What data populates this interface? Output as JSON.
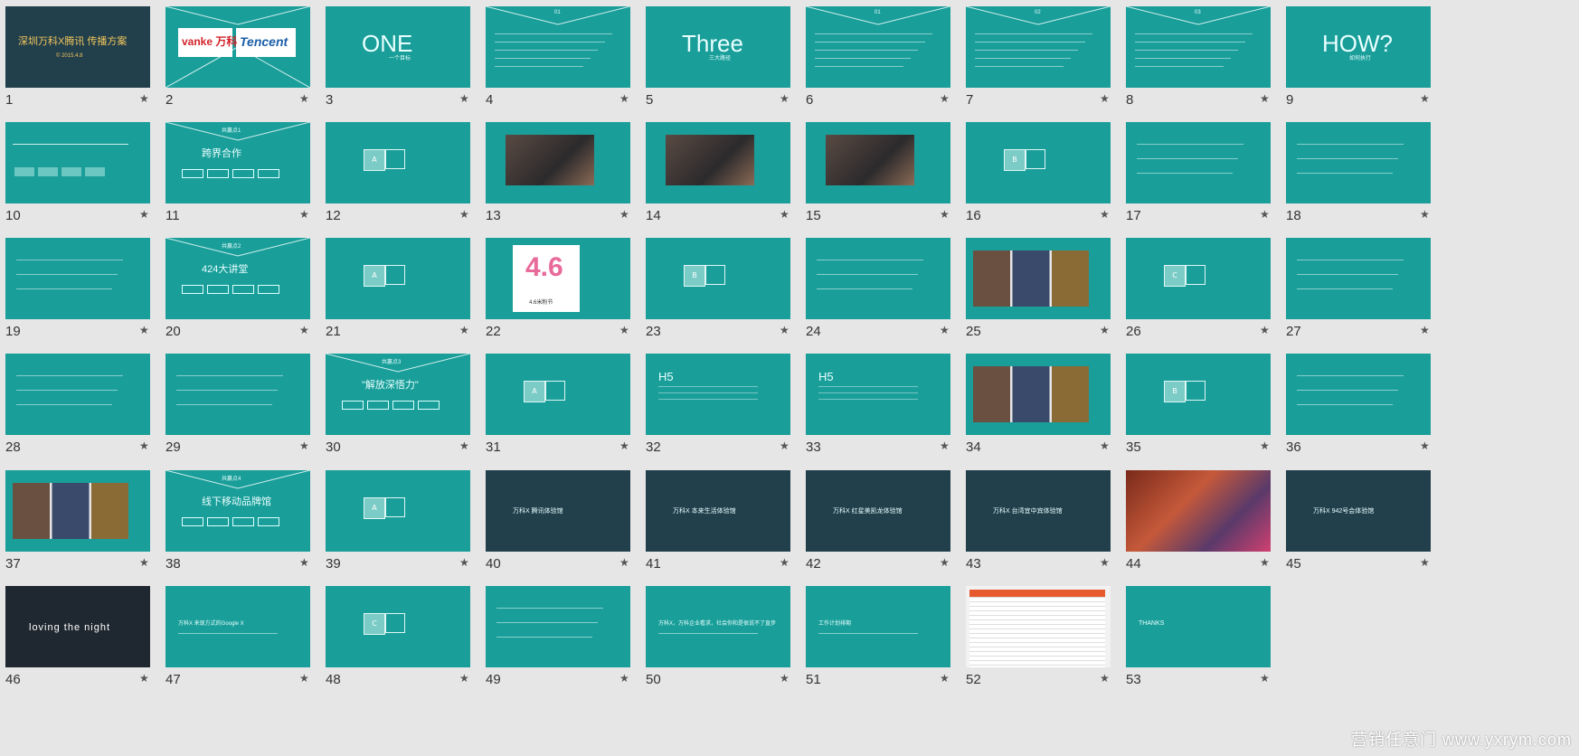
{
  "slides": [
    {
      "n": "1",
      "lines": [
        "深圳万科X腾讯  传播方案",
        "© 2015.4.8"
      ]
    },
    {
      "n": "2",
      "lines": [
        "vanke 万科",
        "Tencent"
      ]
    },
    {
      "n": "3",
      "lines": [
        "ONE",
        "一个目标"
      ]
    },
    {
      "n": "4",
      "lines": [
        "01"
      ]
    },
    {
      "n": "5",
      "lines": [
        "Three",
        "三大路径"
      ]
    },
    {
      "n": "6",
      "lines": [
        "01"
      ]
    },
    {
      "n": "7",
      "lines": [
        "02"
      ]
    },
    {
      "n": "8",
      "lines": [
        "03"
      ]
    },
    {
      "n": "9",
      "lines": [
        "HOW?",
        "如何执行"
      ]
    },
    {
      "n": "10",
      "lines": []
    },
    {
      "n": "11",
      "lines": [
        "共赢点1",
        "跨界合作"
      ]
    },
    {
      "n": "12",
      "lines": [
        "A"
      ]
    },
    {
      "n": "13",
      "lines": []
    },
    {
      "n": "14",
      "lines": []
    },
    {
      "n": "15",
      "lines": []
    },
    {
      "n": "16",
      "lines": [
        "B"
      ]
    },
    {
      "n": "17",
      "lines": []
    },
    {
      "n": "18",
      "lines": []
    },
    {
      "n": "19",
      "lines": []
    },
    {
      "n": "20",
      "lines": [
        "共赢点2",
        "424大讲堂"
      ]
    },
    {
      "n": "21",
      "lines": [
        "A"
      ]
    },
    {
      "n": "22",
      "lines": [
        "4.6",
        "4.6米粉节"
      ]
    },
    {
      "n": "23",
      "lines": [
        "B"
      ]
    },
    {
      "n": "24",
      "lines": []
    },
    {
      "n": "25",
      "lines": []
    },
    {
      "n": "26",
      "lines": [
        "C"
      ]
    },
    {
      "n": "27",
      "lines": []
    },
    {
      "n": "28",
      "lines": []
    },
    {
      "n": "29",
      "lines": []
    },
    {
      "n": "30",
      "lines": [
        "共赢点3",
        "\"解放深悟力\""
      ]
    },
    {
      "n": "31",
      "lines": [
        "A"
      ]
    },
    {
      "n": "32",
      "lines": [
        "H5"
      ]
    },
    {
      "n": "33",
      "lines": [
        "H5"
      ]
    },
    {
      "n": "34",
      "lines": []
    },
    {
      "n": "35",
      "lines": [
        "B"
      ]
    },
    {
      "n": "36",
      "lines": []
    },
    {
      "n": "37",
      "lines": []
    },
    {
      "n": "38",
      "lines": [
        "共赢点4",
        "线下移动品牌馆"
      ]
    },
    {
      "n": "39",
      "lines": [
        "A"
      ]
    },
    {
      "n": "40",
      "lines": [
        "万科X  腾讯体验馆"
      ]
    },
    {
      "n": "41",
      "lines": [
        "万科X  本来生活体验馆"
      ]
    },
    {
      "n": "42",
      "lines": [
        "万科X  红星美凯龙体验馆"
      ]
    },
    {
      "n": "43",
      "lines": [
        "万科X  台湾宜中宾体验馆"
      ]
    },
    {
      "n": "44",
      "lines": []
    },
    {
      "n": "45",
      "lines": [
        "万科X  942号会体验馆"
      ]
    },
    {
      "n": "46",
      "lines": [
        "loving the night"
      ]
    },
    {
      "n": "47",
      "lines": [
        "万科X  来现方式的Google X"
      ]
    },
    {
      "n": "48",
      "lines": [
        "C"
      ]
    },
    {
      "n": "49",
      "lines": []
    },
    {
      "n": "50",
      "lines": [
        "万科X，万科企业看求，社会你和是很说不了直步"
      ]
    },
    {
      "n": "51",
      "lines": [
        "工作计划排期"
      ]
    },
    {
      "n": "52",
      "lines": []
    },
    {
      "n": "53",
      "lines": [
        "THANKS"
      ]
    }
  ],
  "star_symbol": "★",
  "watermark": "营销任意门 www.yxrym.com",
  "colors": {
    "teal": "#1a9e99",
    "dark": "#223f4c",
    "background": "#e6e6e6"
  }
}
